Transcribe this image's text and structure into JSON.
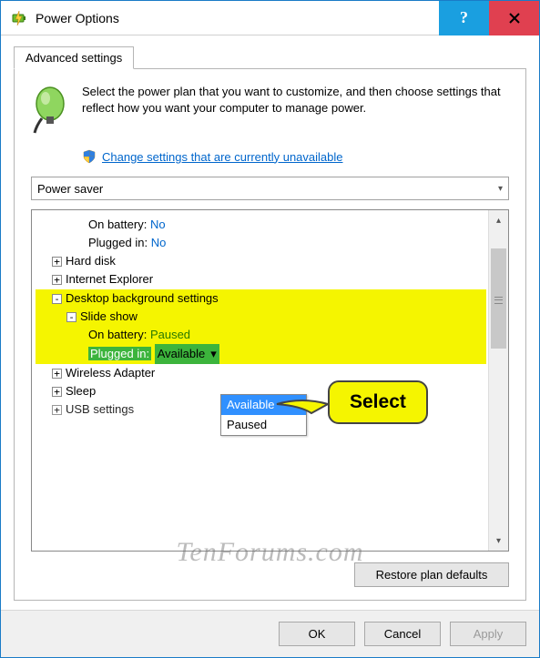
{
  "title": "Power Options",
  "tab": "Advanced settings",
  "description": "Select the power plan that you want to customize, and then choose settings that reflect how you want your computer to manage power.",
  "change_link": "Change settings that are currently unavailable",
  "plan": "Power saver",
  "tree": {
    "on_battery_label": "On battery:",
    "on_battery_val": "No",
    "plugged_in_label": "Plugged in:",
    "plugged_in_val": "No",
    "hard_disk": "Hard disk",
    "ie": "Internet Explorer",
    "desktop_bg": "Desktop background settings",
    "slide_show": "Slide show",
    "ss_on_battery_label": "On battery:",
    "ss_on_battery_val": "Paused",
    "ss_plugged_label": "Plugged in:",
    "ss_plugged_val": "Available",
    "wireless": "Wireless Adapter",
    "sleep": "Sleep",
    "usb": "USB settings"
  },
  "dropdown": {
    "opt1": "Available",
    "opt2": "Paused"
  },
  "callout": "Select",
  "restore": "Restore plan defaults",
  "ok": "OK",
  "cancel": "Cancel",
  "apply": "Apply",
  "watermark": "TenForums.com"
}
